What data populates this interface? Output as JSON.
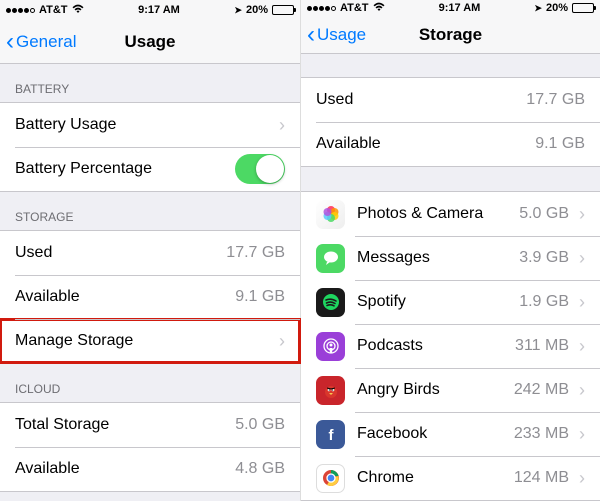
{
  "left": {
    "status": {
      "carrier": "AT&T",
      "time": "9:17 AM",
      "battery": "20%"
    },
    "nav": {
      "back": "General",
      "title": "Usage"
    },
    "battery_header": "BATTERY",
    "battery_usage": "Battery Usage",
    "battery_percentage": "Battery Percentage",
    "storage_header": "STORAGE",
    "used_label": "Used",
    "used_value": "17.7 GB",
    "available_label": "Available",
    "available_value": "9.1 GB",
    "manage_storage": "Manage Storage",
    "icloud_header": "ICLOUD",
    "total_label": "Total Storage",
    "total_value": "5.0 GB",
    "icloud_avail_label": "Available",
    "icloud_avail_value": "4.8 GB"
  },
  "right": {
    "status": {
      "carrier": "AT&T",
      "time": "9:17 AM",
      "battery": "20%"
    },
    "nav": {
      "back": "Usage",
      "title": "Storage"
    },
    "used_label": "Used",
    "used_value": "17.7 GB",
    "available_label": "Available",
    "available_value": "9.1 GB",
    "apps": [
      {
        "name": "Photos & Camera",
        "size": "5.0 GB"
      },
      {
        "name": "Messages",
        "size": "3.9 GB"
      },
      {
        "name": "Spotify",
        "size": "1.9 GB"
      },
      {
        "name": "Podcasts",
        "size": "311 MB"
      },
      {
        "name": "Angry Birds",
        "size": "242 MB"
      },
      {
        "name": "Facebook",
        "size": "233 MB"
      },
      {
        "name": "Chrome",
        "size": "124 MB"
      }
    ]
  }
}
